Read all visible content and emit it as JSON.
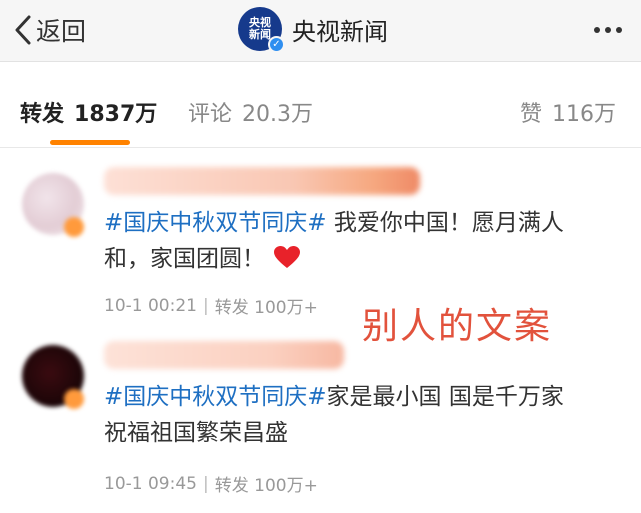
{
  "navbar": {
    "back_label": "返回",
    "account_name": "央视新闻",
    "logo_text_line1": "央视",
    "logo_text_line2": "新闻",
    "more_icon": "more-dots-icon"
  },
  "tabs": [
    {
      "label": "转发",
      "count": "1837万",
      "active": true
    },
    {
      "label": "评论",
      "count": "20.3万",
      "active": false
    },
    {
      "label": "赞",
      "count": "116万",
      "active": false
    }
  ],
  "colors": {
    "accent": "#ff8200",
    "topic": "#1e6fc2",
    "annotation": "#e2523c",
    "verified": "#2f8ff0"
  },
  "reposts": [
    {
      "topic": "#国庆中秋双节同庆#",
      "text_line1": " 我爱你中国！愿月满人",
      "text_line2": "和，家国团圆！",
      "emoji": "heart",
      "time": "10-1 00:21",
      "repost_label": "转发",
      "repost_count": "100万+"
    },
    {
      "topic": "#国庆中秋双节同庆#",
      "text_line1": "家是最小国 国是千万家",
      "text_line2": "祝福祖国繁荣昌盛",
      "time": "10-1 09:45",
      "repost_label": "转发",
      "repost_count": "100万+"
    }
  ],
  "annotation": "别人的文案"
}
